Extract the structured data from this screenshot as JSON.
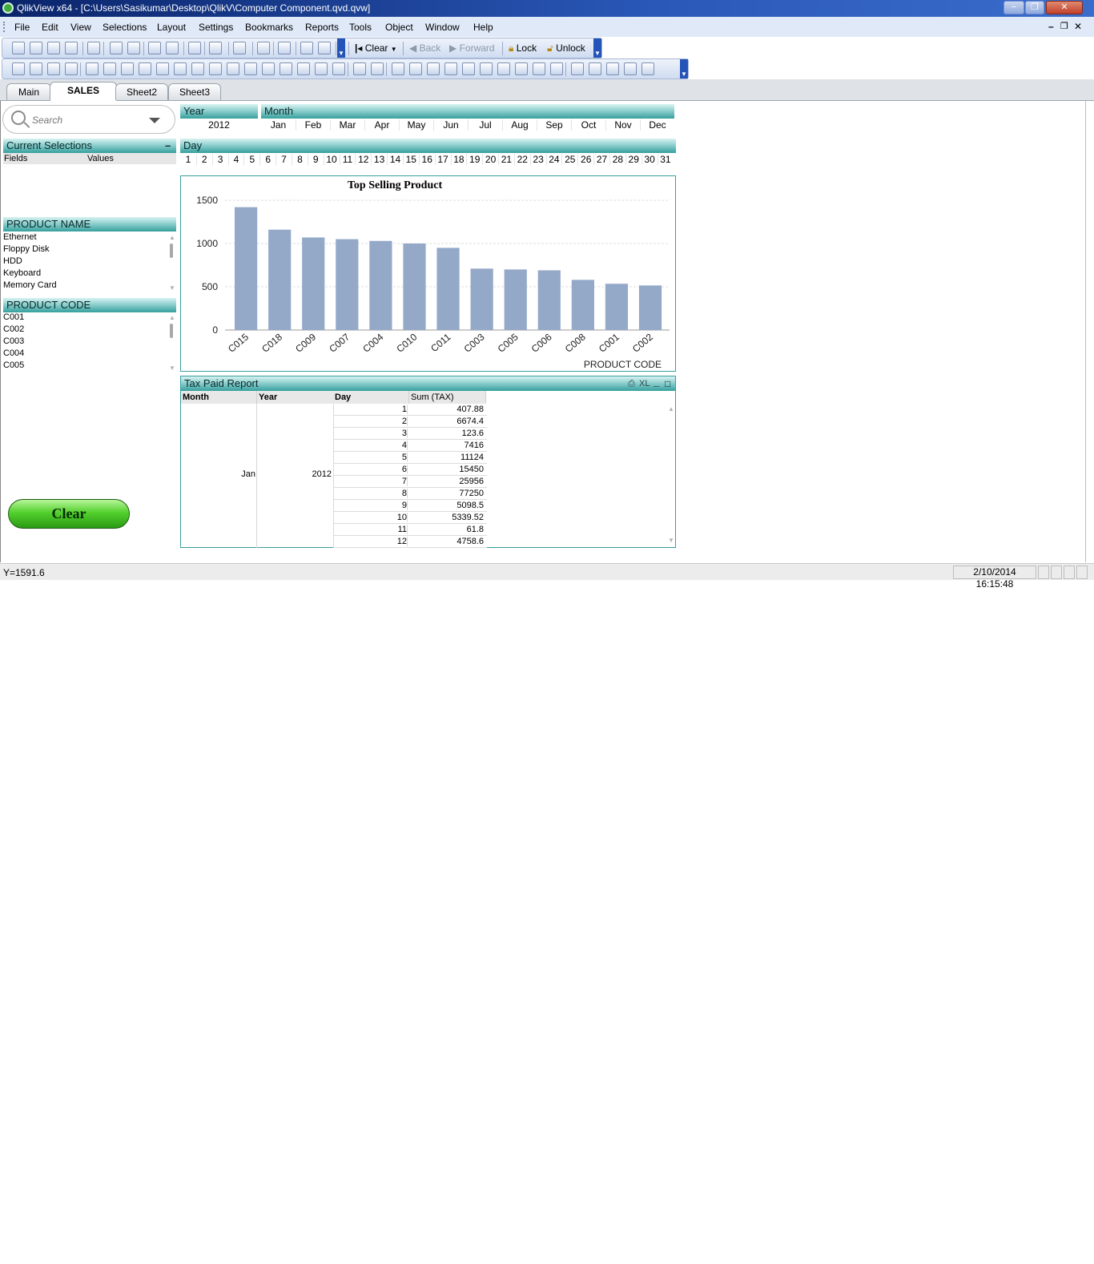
{
  "window": {
    "title": "QlikView x64 - [C:\\Users\\Sasikumar\\Desktop\\QlikV\\Computer Component.qvd.qvw]",
    "minimize": "−",
    "restore": "❐",
    "close": "✕"
  },
  "menu": [
    "File",
    "Edit",
    "View",
    "Selections",
    "Layout",
    "Settings",
    "Bookmarks",
    "Reports",
    "Tools",
    "Object",
    "Window",
    "Help"
  ],
  "mdi": {
    "minimize": "–",
    "restore": "❐",
    "close": "✕"
  },
  "toolbar": {
    "clear": "Clear",
    "back": "Back",
    "forward": "Forward",
    "lock": "Lock",
    "unlock": "Unlock"
  },
  "tabs": [
    "Main",
    "SALES",
    "Sheet2",
    "Sheet3"
  ],
  "active_tab": "SALES",
  "search": {
    "placeholder": "Search"
  },
  "current_selections": {
    "title": "Current Selections",
    "col_fields": "Fields",
    "col_values": "Values",
    "minimize": "–"
  },
  "product_name": {
    "title": "PRODUCT NAME",
    "items": [
      "Ethernet",
      "Floppy Disk",
      "HDD",
      "Keyboard",
      "Memory Card"
    ]
  },
  "product_code": {
    "title": "PRODUCT CODE",
    "items": [
      "C001",
      "C002",
      "C003",
      "C004",
      "C005"
    ]
  },
  "year": {
    "title": "Year",
    "values": [
      "2012"
    ]
  },
  "month": {
    "title": "Month",
    "values": [
      "Jan",
      "Feb",
      "Mar",
      "Apr",
      "May",
      "Jun",
      "Jul",
      "Aug",
      "Sep",
      "Oct",
      "Nov",
      "Dec"
    ]
  },
  "day": {
    "title": "Day",
    "values": [
      "1",
      "2",
      "3",
      "4",
      "5",
      "6",
      "7",
      "8",
      "9",
      "10",
      "11",
      "12",
      "13",
      "14",
      "15",
      "16",
      "17",
      "18",
      "19",
      "20",
      "21",
      "22",
      "23",
      "24",
      "25",
      "26",
      "27",
      "28",
      "29",
      "30",
      "31"
    ]
  },
  "clear_button": "Clear",
  "chart_data": {
    "type": "bar",
    "title": "Top Selling Product",
    "xlabel": "PRODUCT CODE",
    "ylabel": "",
    "categories": [
      "C015",
      "C018",
      "C009",
      "C007",
      "C004",
      "C010",
      "C011",
      "C003",
      "C005",
      "C006",
      "C008",
      "C001",
      "C002"
    ],
    "values": [
      1420,
      1160,
      1070,
      1050,
      1030,
      1000,
      950,
      710,
      700,
      690,
      580,
      535,
      515
    ],
    "ylim": [
      0,
      1500
    ],
    "yticks": [
      0,
      500,
      1000,
      1500
    ],
    "grid": true,
    "bar_color": "#94a8c8"
  },
  "tax_report": {
    "title": "Tax Paid Report",
    "xl": "XL",
    "columns": [
      "Month",
      "Year",
      "Day",
      "Sum (TAX)"
    ],
    "month": "Jan",
    "year": "2012",
    "rows": [
      {
        "day": "1",
        "tax": "407.88"
      },
      {
        "day": "2",
        "tax": "6674.4"
      },
      {
        "day": "3",
        "tax": "123.6"
      },
      {
        "day": "4",
        "tax": "7416"
      },
      {
        "day": "5",
        "tax": "11124"
      },
      {
        "day": "6",
        "tax": "15450"
      },
      {
        "day": "7",
        "tax": "25956"
      },
      {
        "day": "8",
        "tax": "77250"
      },
      {
        "day": "9",
        "tax": "5098.5"
      },
      {
        "day": "10",
        "tax": "5339.52"
      },
      {
        "day": "11",
        "tax": "61.8"
      },
      {
        "day": "12",
        "tax": "4758.6"
      }
    ]
  },
  "status": {
    "left": "Y=1591.6",
    "datetime": "2/10/2014 16:15:48"
  }
}
